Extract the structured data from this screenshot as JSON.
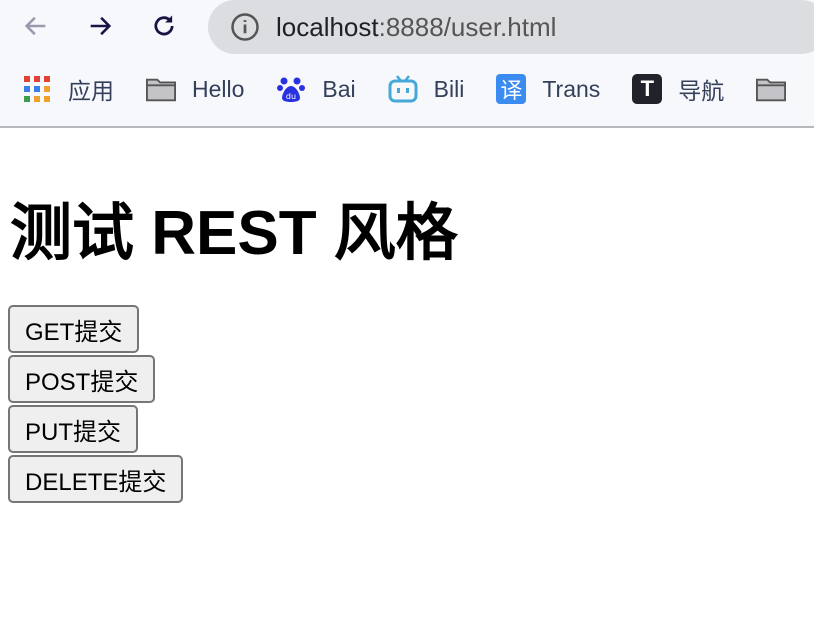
{
  "browser": {
    "url_host": "localhost",
    "url_rest": ":8888/user.html",
    "bookmarks": [
      {
        "label": "应用",
        "icon": "apps-grid-icon"
      },
      {
        "label": "Hello",
        "icon": "folder-icon"
      },
      {
        "label": "Bai",
        "icon": "baidu-icon"
      },
      {
        "label": "Bili",
        "icon": "bilibili-icon"
      },
      {
        "label": "Trans",
        "icon": "translate-icon"
      },
      {
        "label": "导航",
        "icon": "t-logo-icon"
      }
    ]
  },
  "page": {
    "title": "测试 REST 风格",
    "buttons": [
      {
        "label": "GET提交"
      },
      {
        "label": "POST提交"
      },
      {
        "label": "PUT提交"
      },
      {
        "label": "DELETE提交"
      }
    ]
  }
}
